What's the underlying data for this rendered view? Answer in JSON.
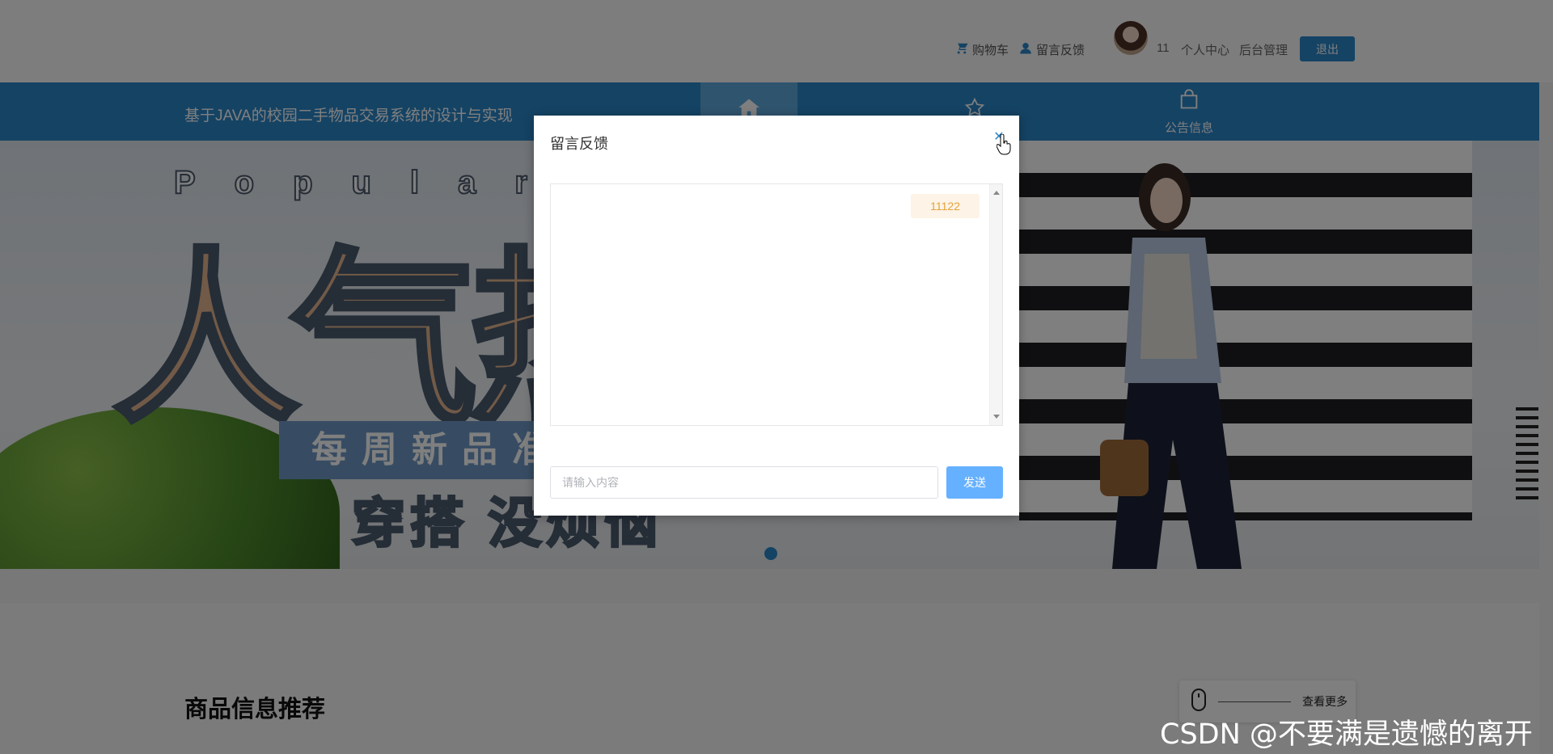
{
  "header": {
    "cart_label": "购物车",
    "feedback_label": "留言反馈",
    "username": "11",
    "personal_center_label": "个人中心",
    "admin_label": "后台管理",
    "logout_label": "退出"
  },
  "nav": {
    "site_title": "基于JAVA的校园二手物品交易系统的设计与实现",
    "items": [
      {
        "icon": "home-icon",
        "label": ""
      },
      {
        "icon": "star-icon",
        "label": ""
      },
      {
        "icon": "shopping-bag-icon",
        "label": "公告信息"
      }
    ]
  },
  "banner": {
    "popular_text": "Popular",
    "big_text": "人气热",
    "band_text": "每周新品准",
    "sub_text": "穿搭 没烦恼"
  },
  "section": {
    "title": "商品信息推荐",
    "more_label": "查看更多"
  },
  "modal": {
    "title": "留言反馈",
    "messages": [
      {
        "text": "11122",
        "side": "right"
      }
    ],
    "input_placeholder": "请输入内容",
    "input_value": "",
    "send_label": "发送"
  },
  "watermark": "CSDN @不要满是遗憾的离开",
  "colors": {
    "primary": "#2b87c9",
    "send_button": "#66b1ff",
    "message_bubble_bg": "#fdf3e6",
    "message_text": "#e6a23c"
  }
}
